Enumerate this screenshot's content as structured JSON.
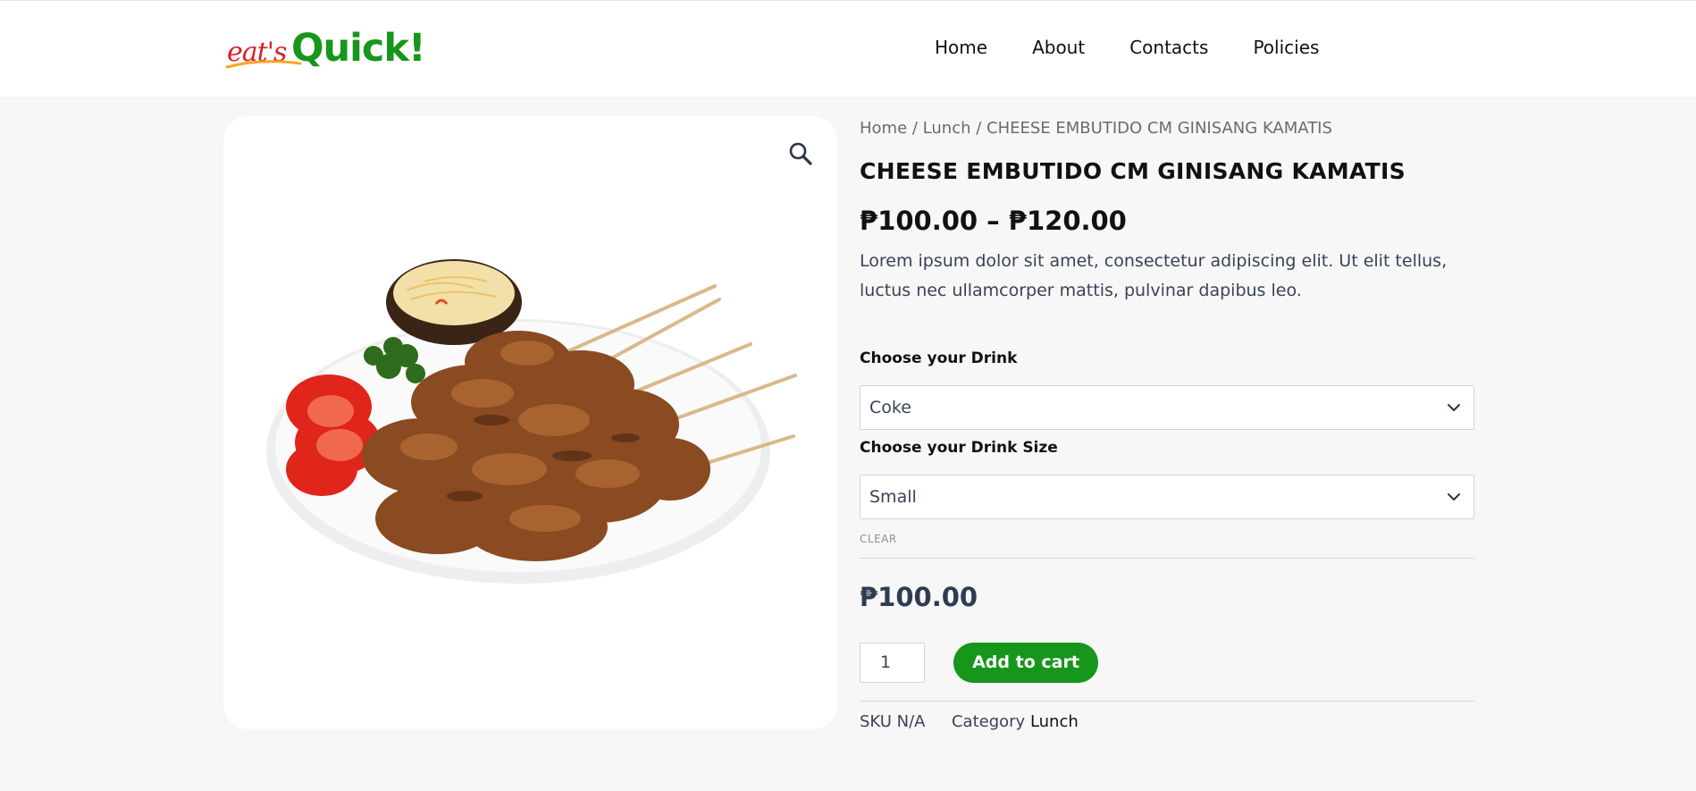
{
  "brand": {
    "logo_script": "eat's",
    "logo_word": "Quick!"
  },
  "nav": {
    "items": [
      "Home",
      "About",
      "Contacts",
      "Policies"
    ]
  },
  "breadcrumb": {
    "home": "Home",
    "sep1": " / ",
    "category": "Lunch",
    "sep2": " / ",
    "current": "CHEESE EMBUTIDO CM GINISANG KAMATIS"
  },
  "product": {
    "title": "CHEESE EMBUTIDO CM GINISANG KAMATIS",
    "price_range": "₱100.00 – ₱120.00",
    "description": "Lorem ipsum dolor sit amet, consectetur adipiscing elit. Ut elit tellus, luctus nec ullamcorper mattis, pulvinar dapibus leo."
  },
  "options": {
    "drink_label": "Choose your Drink",
    "drink_value": "Coke",
    "size_label": "Choose your Drink Size",
    "size_value": "Small",
    "clear_label": "CLEAR"
  },
  "purchase": {
    "variation_price": "₱100.00",
    "quantity": "1",
    "add_to_cart_label": "Add to cart"
  },
  "meta": {
    "sku_label": "SKU",
    "sku_value": "N/A",
    "category_label": "Category",
    "category_value": "Lunch"
  },
  "icons": {
    "zoom": "magnifier-icon",
    "select_arrow": "chevron-down-icon"
  },
  "colors": {
    "brand_green": "#16961b",
    "brand_red": "#d71f26",
    "page_bg": "#f7f7f7"
  }
}
